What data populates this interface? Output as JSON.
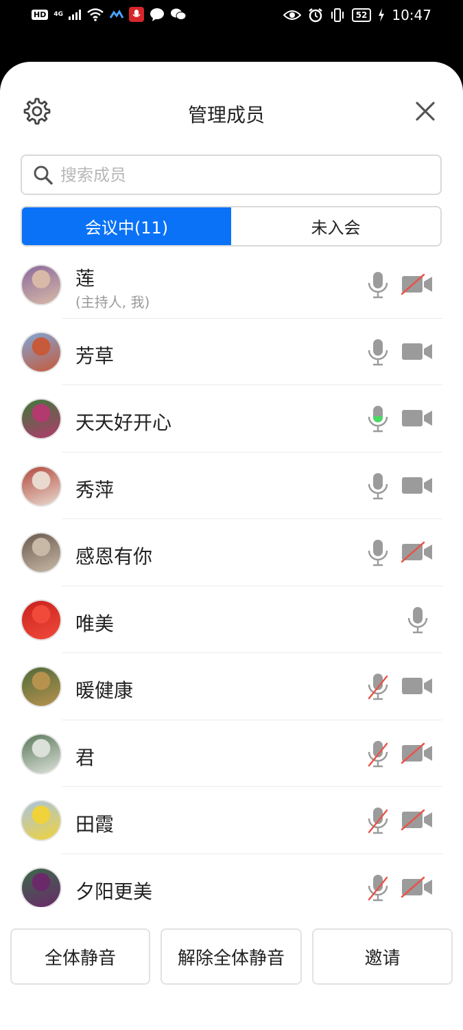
{
  "status_bar": {
    "hd": "HD",
    "network": "4G",
    "battery": "52",
    "time": "10:47"
  },
  "header": {
    "title": "管理成员"
  },
  "search": {
    "placeholder": "搜索成员"
  },
  "tabs": [
    {
      "label": "会议中(11)",
      "active": true
    },
    {
      "label": "未入会",
      "active": false
    }
  ],
  "members": [
    {
      "name": "莲",
      "role": "(主持人, 我)",
      "mic": "on",
      "camera": "off",
      "avatar_colors": [
        "#8a6a9c",
        "#d8b9a7"
      ]
    },
    {
      "name": "芳草",
      "mic": "on",
      "camera": "on",
      "avatar_colors": [
        "#7fa6d6",
        "#c75a3a"
      ]
    },
    {
      "name": "天天好开心",
      "mic": "speaking",
      "camera": "on",
      "avatar_colors": [
        "#3d7a3a",
        "#b23a6e"
      ]
    },
    {
      "name": "秀萍",
      "mic": "on",
      "camera": "on",
      "avatar_colors": [
        "#b24a3e",
        "#e9d9cf"
      ]
    },
    {
      "name": "感恩有你",
      "mic": "on",
      "camera": "off",
      "avatar_colors": [
        "#6a5a4e",
        "#c8b8a6"
      ]
    },
    {
      "name": "唯美",
      "mic": "on",
      "camera": "none",
      "avatar_colors": [
        "#c8211d",
        "#f14a3a"
      ]
    },
    {
      "name": "暖健康",
      "mic": "muted",
      "camera": "on",
      "avatar_colors": [
        "#4e6a3a",
        "#b7924e"
      ]
    },
    {
      "name": "君",
      "mic": "muted",
      "camera": "off",
      "avatar_colors": [
        "#5a7a5a",
        "#dbe0d8"
      ]
    },
    {
      "name": "田霞",
      "mic": "muted",
      "camera": "off",
      "avatar_colors": [
        "#a8c4e0",
        "#f0d23a"
      ]
    },
    {
      "name": "夕阳更美",
      "mic": "muted",
      "camera": "off",
      "avatar_colors": [
        "#3a6a4a",
        "#6a2a6a"
      ]
    }
  ],
  "footer": {
    "mute_all": "全体静音",
    "unmute_all": "解除全体静音",
    "invite": "邀请"
  },
  "colors": {
    "accent": "#0a72f7",
    "icon_gray": "#9b9b9b",
    "speaking_green": "#4cd964",
    "muted_red": "#e8534a"
  }
}
